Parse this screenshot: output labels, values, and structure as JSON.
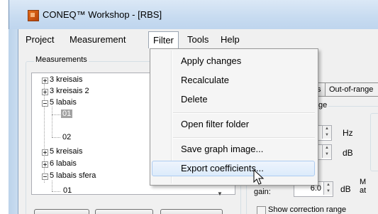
{
  "window": {
    "title": "CONEQ™ Workshop - [RBS]"
  },
  "menubar": {
    "items": [
      {
        "label": "Project"
      },
      {
        "label": "Measurement"
      },
      {
        "label": "Filter"
      },
      {
        "label": "Tools"
      },
      {
        "label": "Help"
      }
    ]
  },
  "filter_menu": {
    "items": [
      {
        "label": "Apply changes"
      },
      {
        "label": "Recalculate"
      },
      {
        "label": "Delete"
      },
      {
        "label": "Open filter folder"
      },
      {
        "label": "Save graph image..."
      },
      {
        "label": "Export coefficients..."
      }
    ],
    "hovered": "Export coefficients..."
  },
  "measurements": {
    "group_label": "Measurements",
    "tree": [
      {
        "label": "3 kreisais",
        "expander": "plus"
      },
      {
        "label": "3 kreisais 2",
        "expander": "plus"
      },
      {
        "label": "5 labais",
        "expander": "minus"
      },
      {
        "label": "01",
        "selected": true
      },
      {
        "label": "02"
      },
      {
        "label": "5 kreisais",
        "expander": "plus"
      },
      {
        "label": "6 labais",
        "expander": "plus"
      },
      {
        "label": "5 labais sfera",
        "expander": "minus"
      },
      {
        "label": "01"
      }
    ]
  },
  "right_panel": {
    "tab_partial": "s",
    "tab_out_of_range": "Out-of-range",
    "range_group_label": "ge",
    "hz_unit": "Hz",
    "db_unit": "dB",
    "max_gain_label": "Maximum gain:",
    "max_gain_value": "6.0",
    "max_gain_unit": "dB",
    "right_cut_label_1": "M",
    "right_cut_label_2": "at",
    "show_correction_label": "Show correction range"
  },
  "colors": {
    "hover_fill": "#dcebfb",
    "hover_border": "#aeccf1",
    "selection": "#a3a3a3"
  }
}
